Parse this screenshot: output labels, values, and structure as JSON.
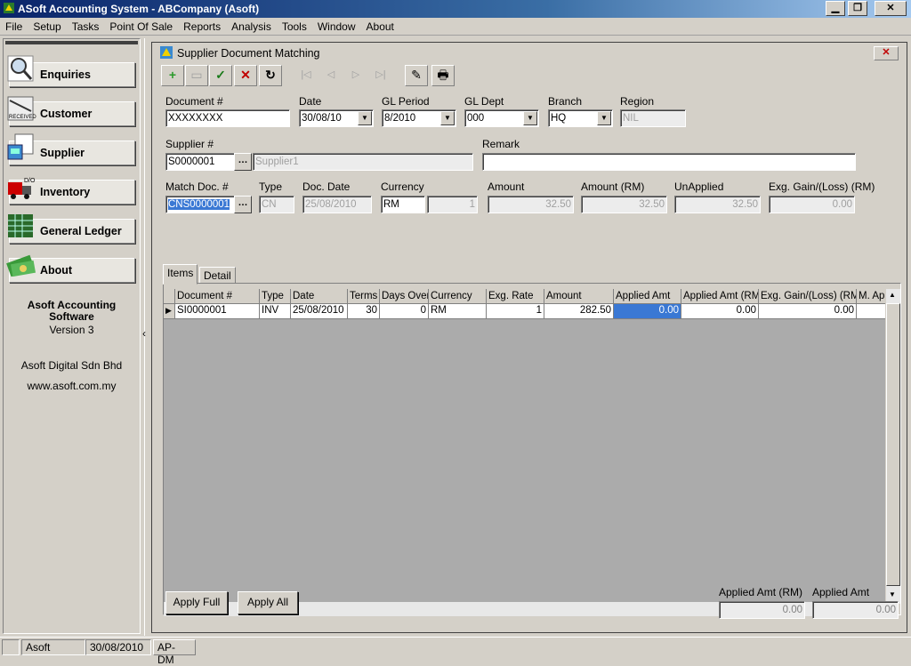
{
  "window": {
    "title": "ASoft Accounting System - ABCompany (Asoft)"
  },
  "menu": [
    "File",
    "Setup",
    "Tasks",
    "Point Of Sale",
    "Reports",
    "Analysis",
    "Tools",
    "Window",
    "About"
  ],
  "nav": {
    "items": [
      {
        "label": "Enquiries",
        "icon": "magnifier-icon"
      },
      {
        "label": "Customer",
        "icon": "received-stamp-icon"
      },
      {
        "label": "Supplier",
        "icon": "supplier-invoice-icon"
      },
      {
        "label": "Inventory",
        "icon": "delivery-order-icon"
      },
      {
        "label": "General Ledger",
        "icon": "ledger-grid-icon"
      },
      {
        "label": "About",
        "icon": "money-icon"
      }
    ],
    "about": {
      "product_line1": "Asoft Accounting",
      "product_line2": "Software",
      "version": "Version 3",
      "company": "Asoft Digital Sdn Bhd",
      "website": "www.asoft.com.my"
    }
  },
  "child": {
    "title": "Supplier Document Matching",
    "close": "✕"
  },
  "toolbar": {
    "new": "+",
    "delete": "▭",
    "save": "✓",
    "cancel": "✕",
    "refresh": "↻",
    "first": "|◁",
    "prev": "◁",
    "next": "▷",
    "last": "▷|",
    "tool": "✎",
    "print": "🖶"
  },
  "form": {
    "document_label": "Document #",
    "document_value": "XXXXXXXX",
    "date_label": "Date",
    "date_value": "30/08/10",
    "glperiod_label": "GL Period",
    "glperiod_value": "8/2010",
    "gldept_label": "GL Dept",
    "gldept_value": "000",
    "branch_label": "Branch",
    "branch_value": "HQ",
    "region_label": "Region",
    "region_value": "NIL",
    "supplier_label": "Supplier #",
    "supplier_value": "S0000001",
    "supplier_name": "Supplier1",
    "remark_label": "Remark",
    "remark_value": "",
    "matchdoc_label": "Match Doc. #",
    "matchdoc_value": "CNS0000001",
    "type_label": "Type",
    "type_value": "CN",
    "docdate_label": "Doc. Date",
    "docdate_value": "25/08/2010",
    "currency_label": "Currency",
    "currency_value": "RM",
    "rate_value": "1",
    "amount_label": "Amount",
    "amount_value": "32.50",
    "amountrm_label": "Amount (RM)",
    "amountrm_value": "32.50",
    "unapplied_label": "UnApplied",
    "unapplied_value": "32.50",
    "exg_label": "Exg. Gain/(Loss) (RM)",
    "exg_value": "0.00"
  },
  "tabs": [
    "Items",
    "Detail"
  ],
  "grid": {
    "columns": [
      "Document #",
      "Type",
      "Date",
      "Terms",
      "Days Over",
      "Currency",
      "Exg. Rate",
      "Amount",
      "Applied Amt",
      "Applied Amt (RM)",
      "Exg. Gain/(Loss) (RM)",
      "M. Ap"
    ],
    "rows": [
      [
        "SI0000001",
        "INV",
        "25/08/2010",
        "30",
        "0",
        "RM",
        "1",
        "282.50",
        "0.00",
        "0.00",
        "0.00",
        ""
      ]
    ]
  },
  "buttons": {
    "apply_full": "Apply Full",
    "apply_all": "Apply All"
  },
  "totals": {
    "applied_rm_label": "Applied Amt (RM)",
    "applied_rm_value": "0.00",
    "applied_label": "Applied Amt",
    "applied_value": "0.00"
  },
  "status": {
    "user": "Asoft",
    "date": "30/08/2010",
    "module": "AP-DM"
  }
}
